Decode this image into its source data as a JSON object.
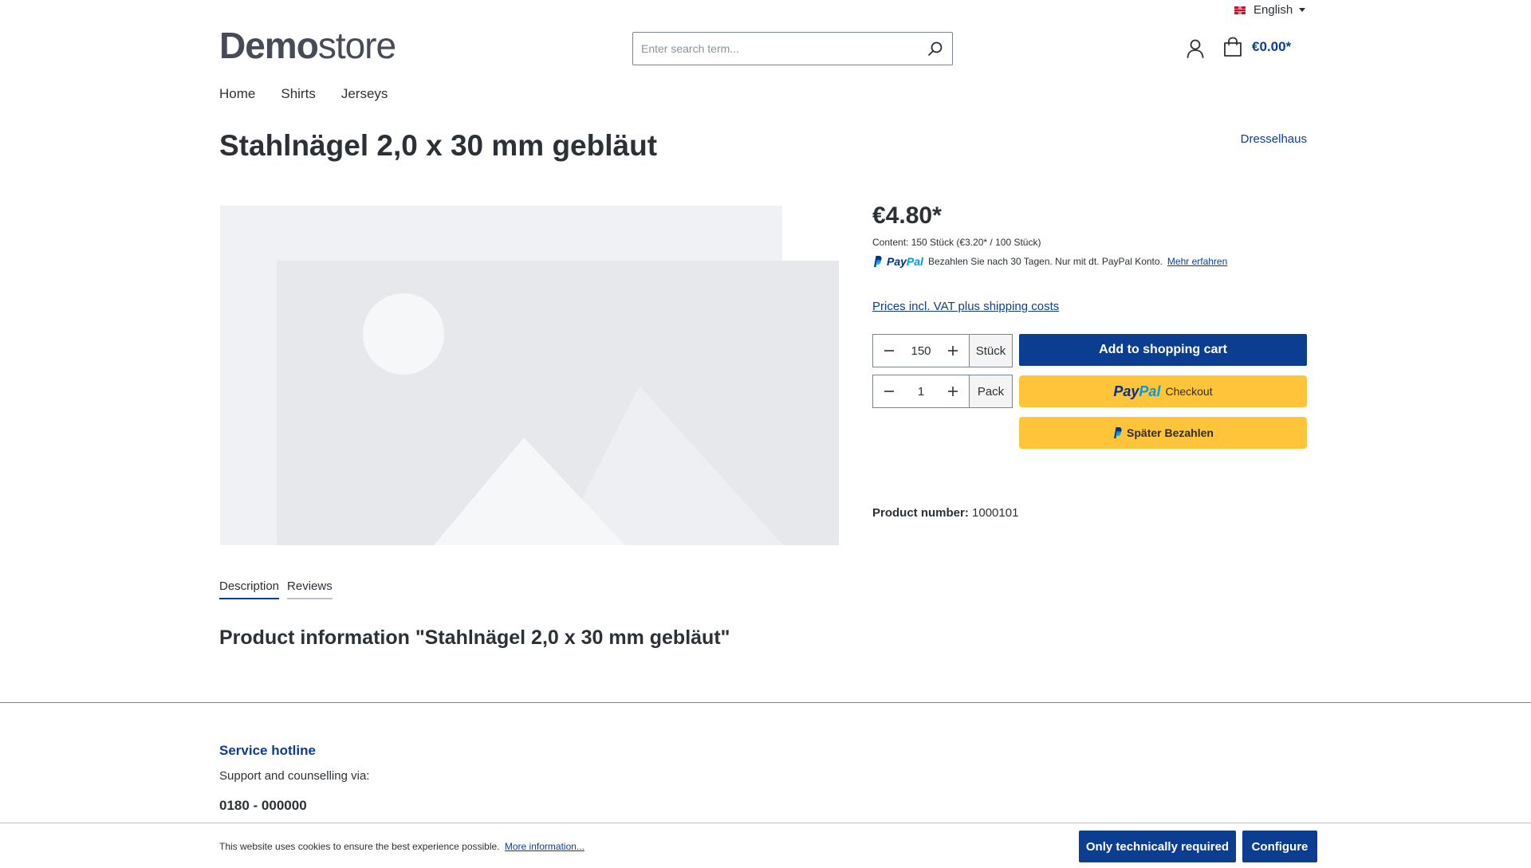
{
  "header": {
    "language": "English",
    "logo_bold": "Demo",
    "logo_light": "store",
    "search_placeholder": "Enter search term...",
    "cart_total": "€0.00*"
  },
  "nav": {
    "items": [
      "Home",
      "Shirts",
      "Jerseys"
    ]
  },
  "product": {
    "title": "Stahlnägel 2,0 x 30 mm gebläut",
    "manufacturer": "Dresselhaus",
    "price": "€4.80*",
    "content_info": "Content: 150 Stück (€3.20* / 100 Stück)",
    "paypal_message": "Bezahlen Sie nach 30 Tagen. Nur mit dt. PayPal Konto.",
    "paypal_more": "Mehr erfahren",
    "vat_link": "Prices incl. VAT plus shipping costs",
    "qty_pieces": "150",
    "unit_pieces": "Stück",
    "qty_packs": "1",
    "unit_packs": "Pack",
    "add_to_cart": "Add to shopping cart",
    "paypal_checkout_label": "Checkout",
    "paypal_later_label": "Später Bezahlen",
    "product_number_label": "Product number:",
    "product_number": "1000101"
  },
  "tabs": [
    "Description",
    "Reviews"
  ],
  "info_heading": "Product information \"Stahlnägel 2,0 x 30 mm gebläut\"",
  "footer": {
    "hotline_title": "Service hotline",
    "hotline_sub": "Support and counselling via:",
    "hotline_phone": "0180 - 000000"
  },
  "cookie": {
    "text": "This website uses cookies to ensure the best experience possible.",
    "more": "More information...",
    "btn_required": "Only technically required",
    "btn_configure": "Configure"
  },
  "colors": {
    "primary": "#0b3e91",
    "paypal_yellow": "#ffc439",
    "text": "#2b3136"
  }
}
